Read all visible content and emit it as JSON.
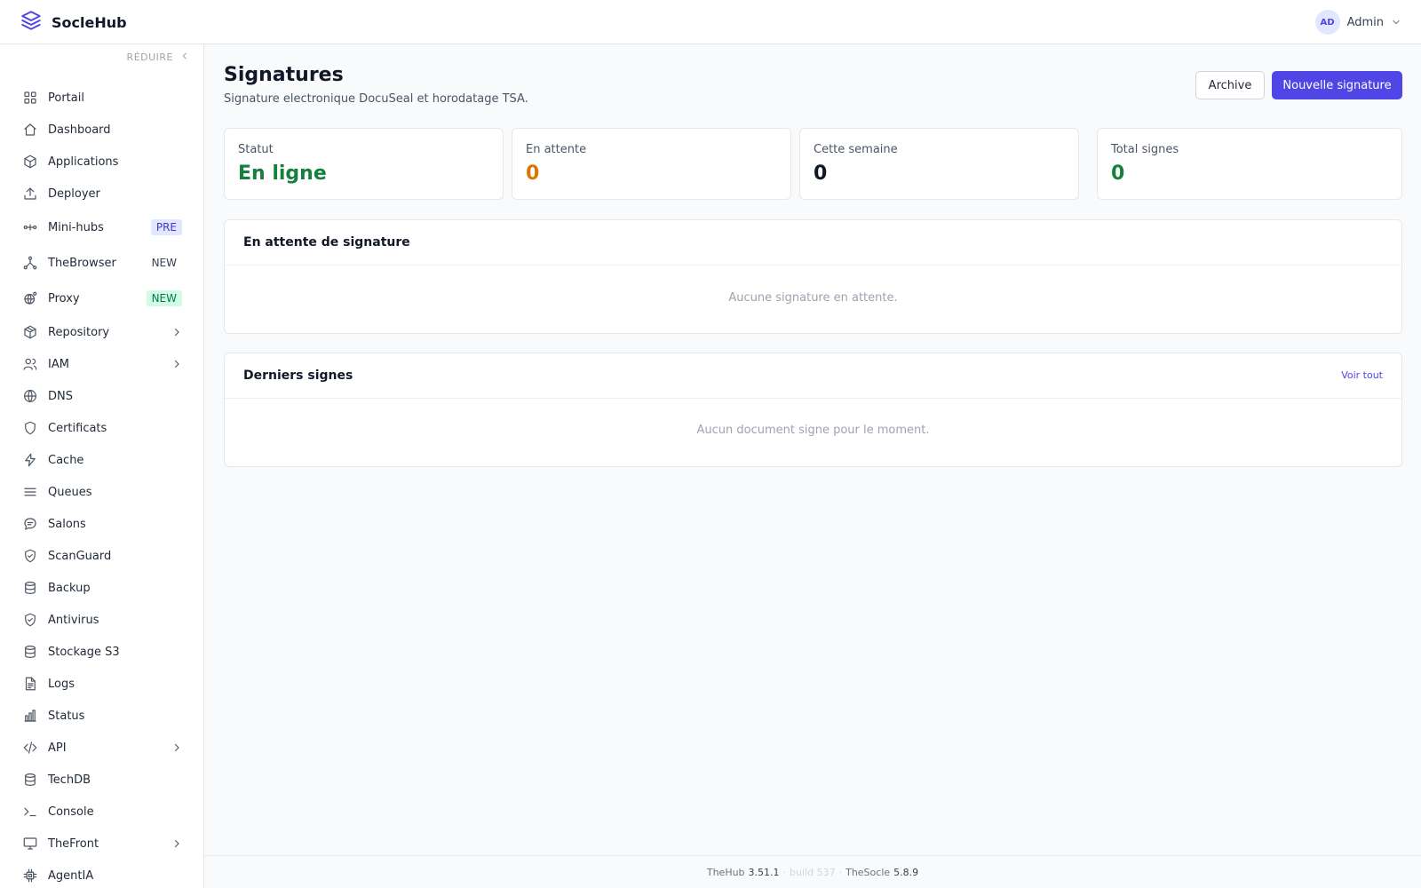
{
  "app": {
    "name": "SocleHub",
    "accent": "#4f46e5"
  },
  "user": {
    "initials": "AD",
    "name": "Admin"
  },
  "sidebar": {
    "collapse_label": "RÉDUIRE",
    "items": [
      {
        "label": "Portail",
        "icon": "grid-icon"
      },
      {
        "label": "Dashboard",
        "icon": "home-icon"
      },
      {
        "label": "Applications",
        "icon": "box-icon"
      },
      {
        "label": "Deployer",
        "icon": "upload-icon"
      },
      {
        "label": "Mini-hubs",
        "icon": "hubs-icon",
        "badge": "PRE"
      },
      {
        "label": "TheBrowser",
        "icon": "network-icon",
        "badge": "NEW"
      },
      {
        "label": "Proxy",
        "icon": "proxy-icon",
        "badge": "NEW"
      },
      {
        "label": "Repository",
        "icon": "package-icon",
        "expandable": true
      },
      {
        "label": "IAM",
        "icon": "users-icon",
        "expandable": true
      },
      {
        "label": "DNS",
        "icon": "globe-icon"
      },
      {
        "label": "Certificats",
        "icon": "shield-icon"
      },
      {
        "label": "Cache",
        "icon": "bolt-icon"
      },
      {
        "label": "Queues",
        "icon": "list-icon"
      },
      {
        "label": "Salons",
        "icon": "chat-icon"
      },
      {
        "label": "ScanGuard",
        "icon": "shield-check-icon"
      },
      {
        "label": "Backup",
        "icon": "database-icon"
      },
      {
        "label": "Antivirus",
        "icon": "shield-check-icon"
      },
      {
        "label": "Stockage S3",
        "icon": "database-icon"
      },
      {
        "label": "Logs",
        "icon": "file-icon"
      },
      {
        "label": "Status",
        "icon": "bar-chart-icon"
      },
      {
        "label": "API",
        "icon": "code-icon",
        "expandable": true
      },
      {
        "label": "TechDB",
        "icon": "database-icon"
      },
      {
        "label": "Console",
        "icon": "terminal-icon"
      },
      {
        "label": "TheFront",
        "icon": "monitor-icon",
        "expandable": true
      },
      {
        "label": "AgentIA",
        "icon": "cpu-icon"
      }
    ]
  },
  "page": {
    "title": "Signatures",
    "subtitle": "Signature electronique DocuSeal et horodatage TSA.",
    "archive_label": "Archive",
    "new_label": "Nouvelle signature"
  },
  "stats": [
    {
      "label": "Statut",
      "value": "En ligne",
      "color": "#15803d"
    },
    {
      "label": "En attente",
      "value": "0",
      "color": "#d97706"
    },
    {
      "label": "Cette semaine",
      "value": "0",
      "color": "#111827"
    },
    {
      "label": "Total signes",
      "value": "0",
      "color": "#15803d"
    }
  ],
  "pending_panel": {
    "title": "En attente de signature",
    "empty": "Aucune signature en attente."
  },
  "recent_panel": {
    "title": "Derniers signes",
    "link": "Voir tout",
    "empty": "Aucun document signe pour le moment."
  },
  "footer": {
    "app": "TheHub",
    "app_version": "3.51.1",
    "sep1": "·",
    "build": "build 537",
    "sep2": "·",
    "socle": "TheSocle",
    "socle_version": "5.8.9"
  }
}
